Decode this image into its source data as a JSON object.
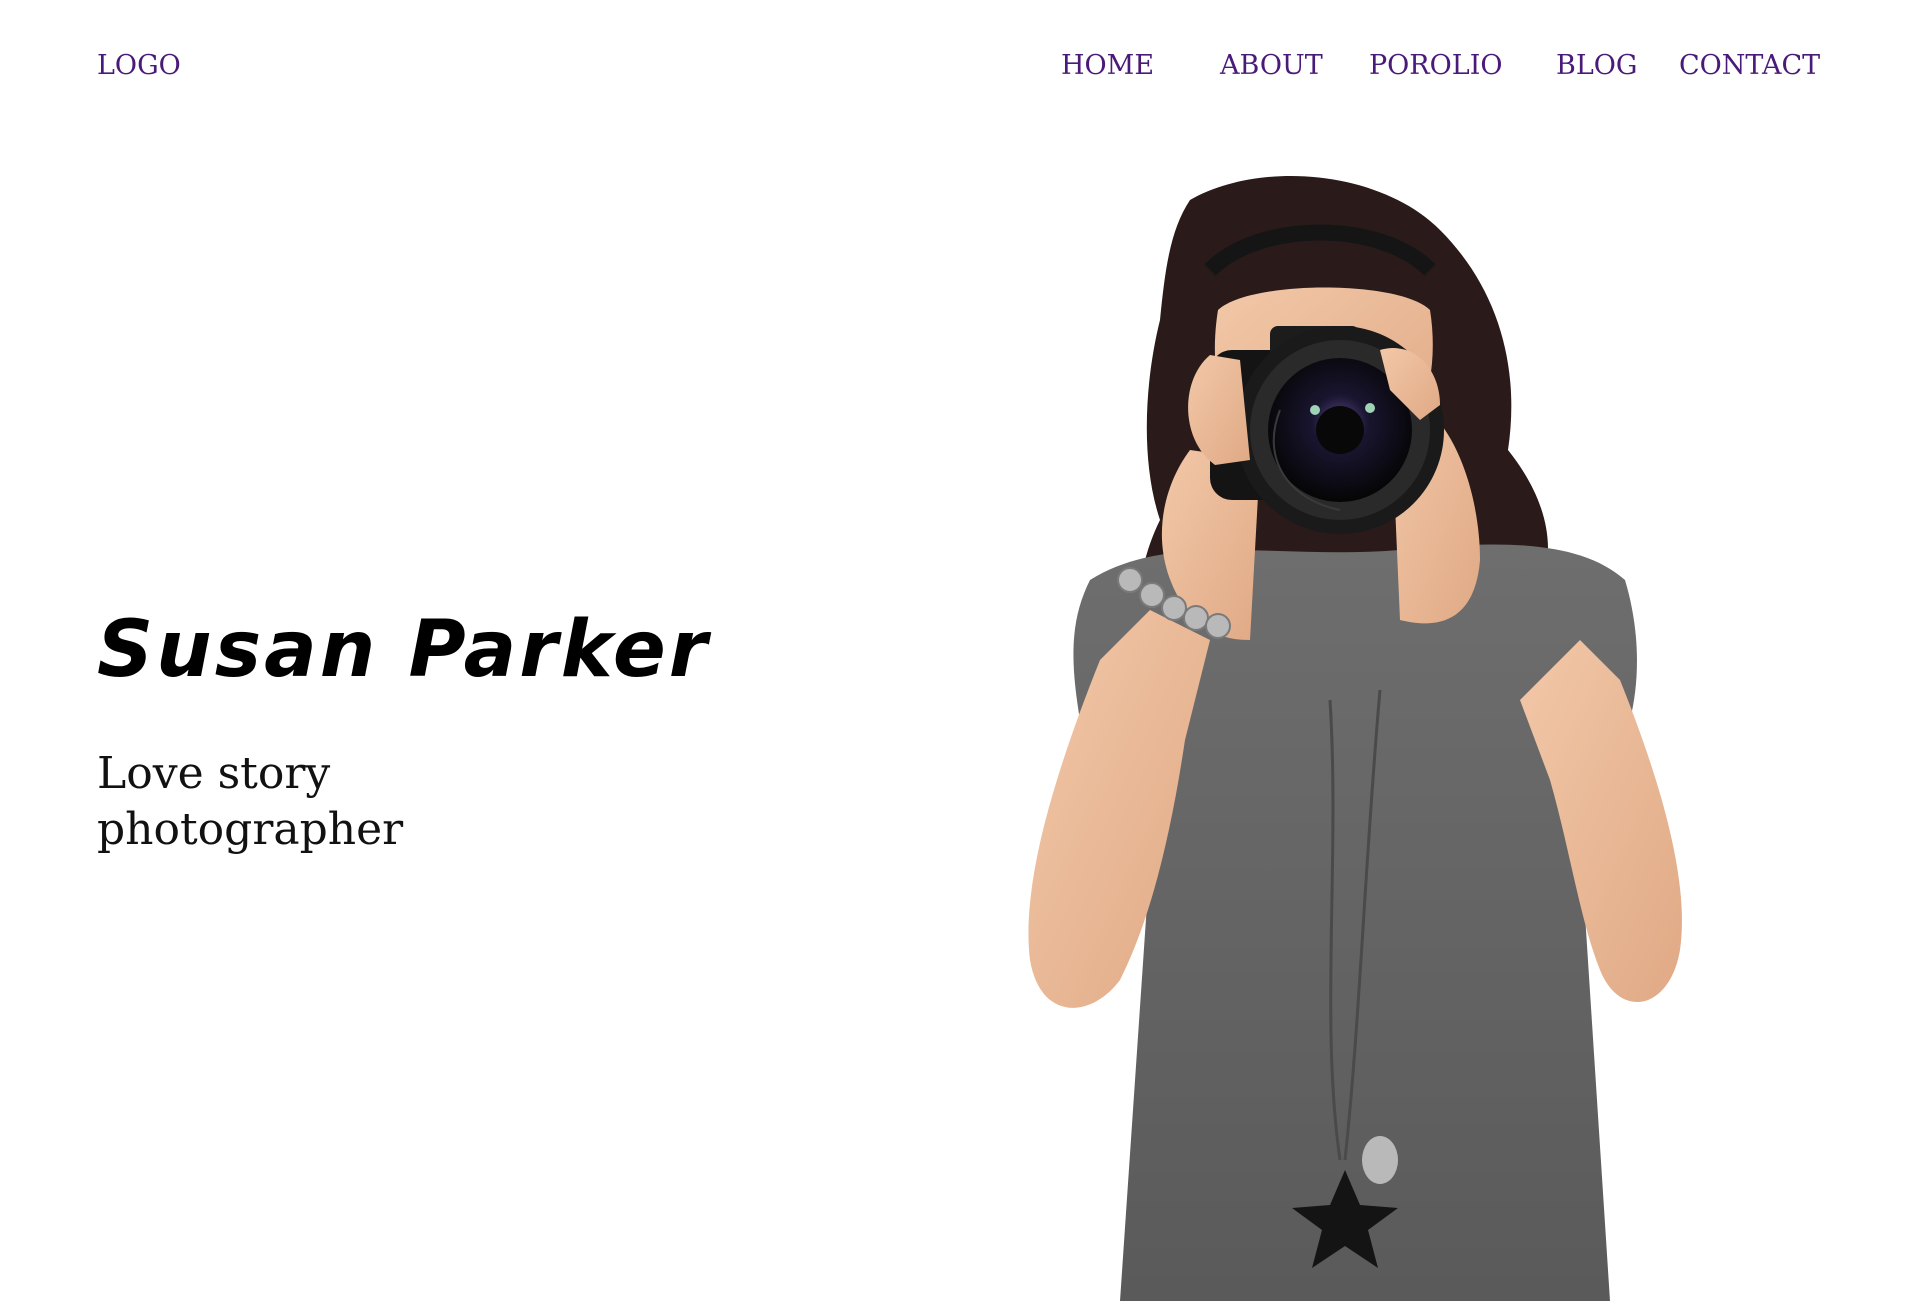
{
  "header": {
    "logo": "LOGO",
    "nav": [
      "HOME",
      "ABOUT",
      "POROLIO",
      "BLOG",
      "CONTACT"
    ]
  },
  "hero": {
    "title": "Susan Parker",
    "subtitle": "Love story photographer"
  },
  "colors": {
    "nav_text": "#4a1a78",
    "title_text": "#000000",
    "background": "#ffffff"
  }
}
